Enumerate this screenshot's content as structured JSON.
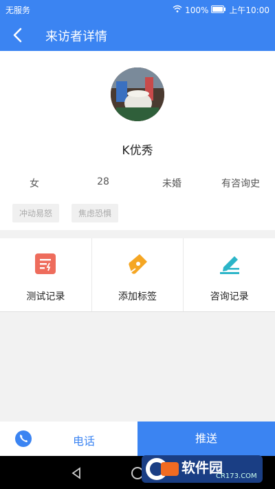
{
  "status": {
    "carrier": "无服务",
    "battery": "100%",
    "time": "上午10:00"
  },
  "header": {
    "title": "来访者详情"
  },
  "profile": {
    "name": "K优秀",
    "gender": "女",
    "age": "28",
    "marital": "未婚",
    "history": "有咨询史",
    "tags": [
      "冲动易怒",
      "焦虑恐惧"
    ]
  },
  "actions": [
    {
      "label": "测试记录",
      "icon": "test-record-icon"
    },
    {
      "label": "添加标签",
      "icon": "add-tag-icon"
    },
    {
      "label": "咨询记录",
      "icon": "consult-record-icon"
    }
  ],
  "footer": {
    "phone_label": "电话",
    "push_label": "推送"
  },
  "watermark": {
    "text": "软件园",
    "sub": "CR173.COM"
  },
  "colors": {
    "primary": "#3b84f2",
    "orange": "#f5a623",
    "red": "#ee6c5c",
    "teal": "#2bb5c8"
  }
}
